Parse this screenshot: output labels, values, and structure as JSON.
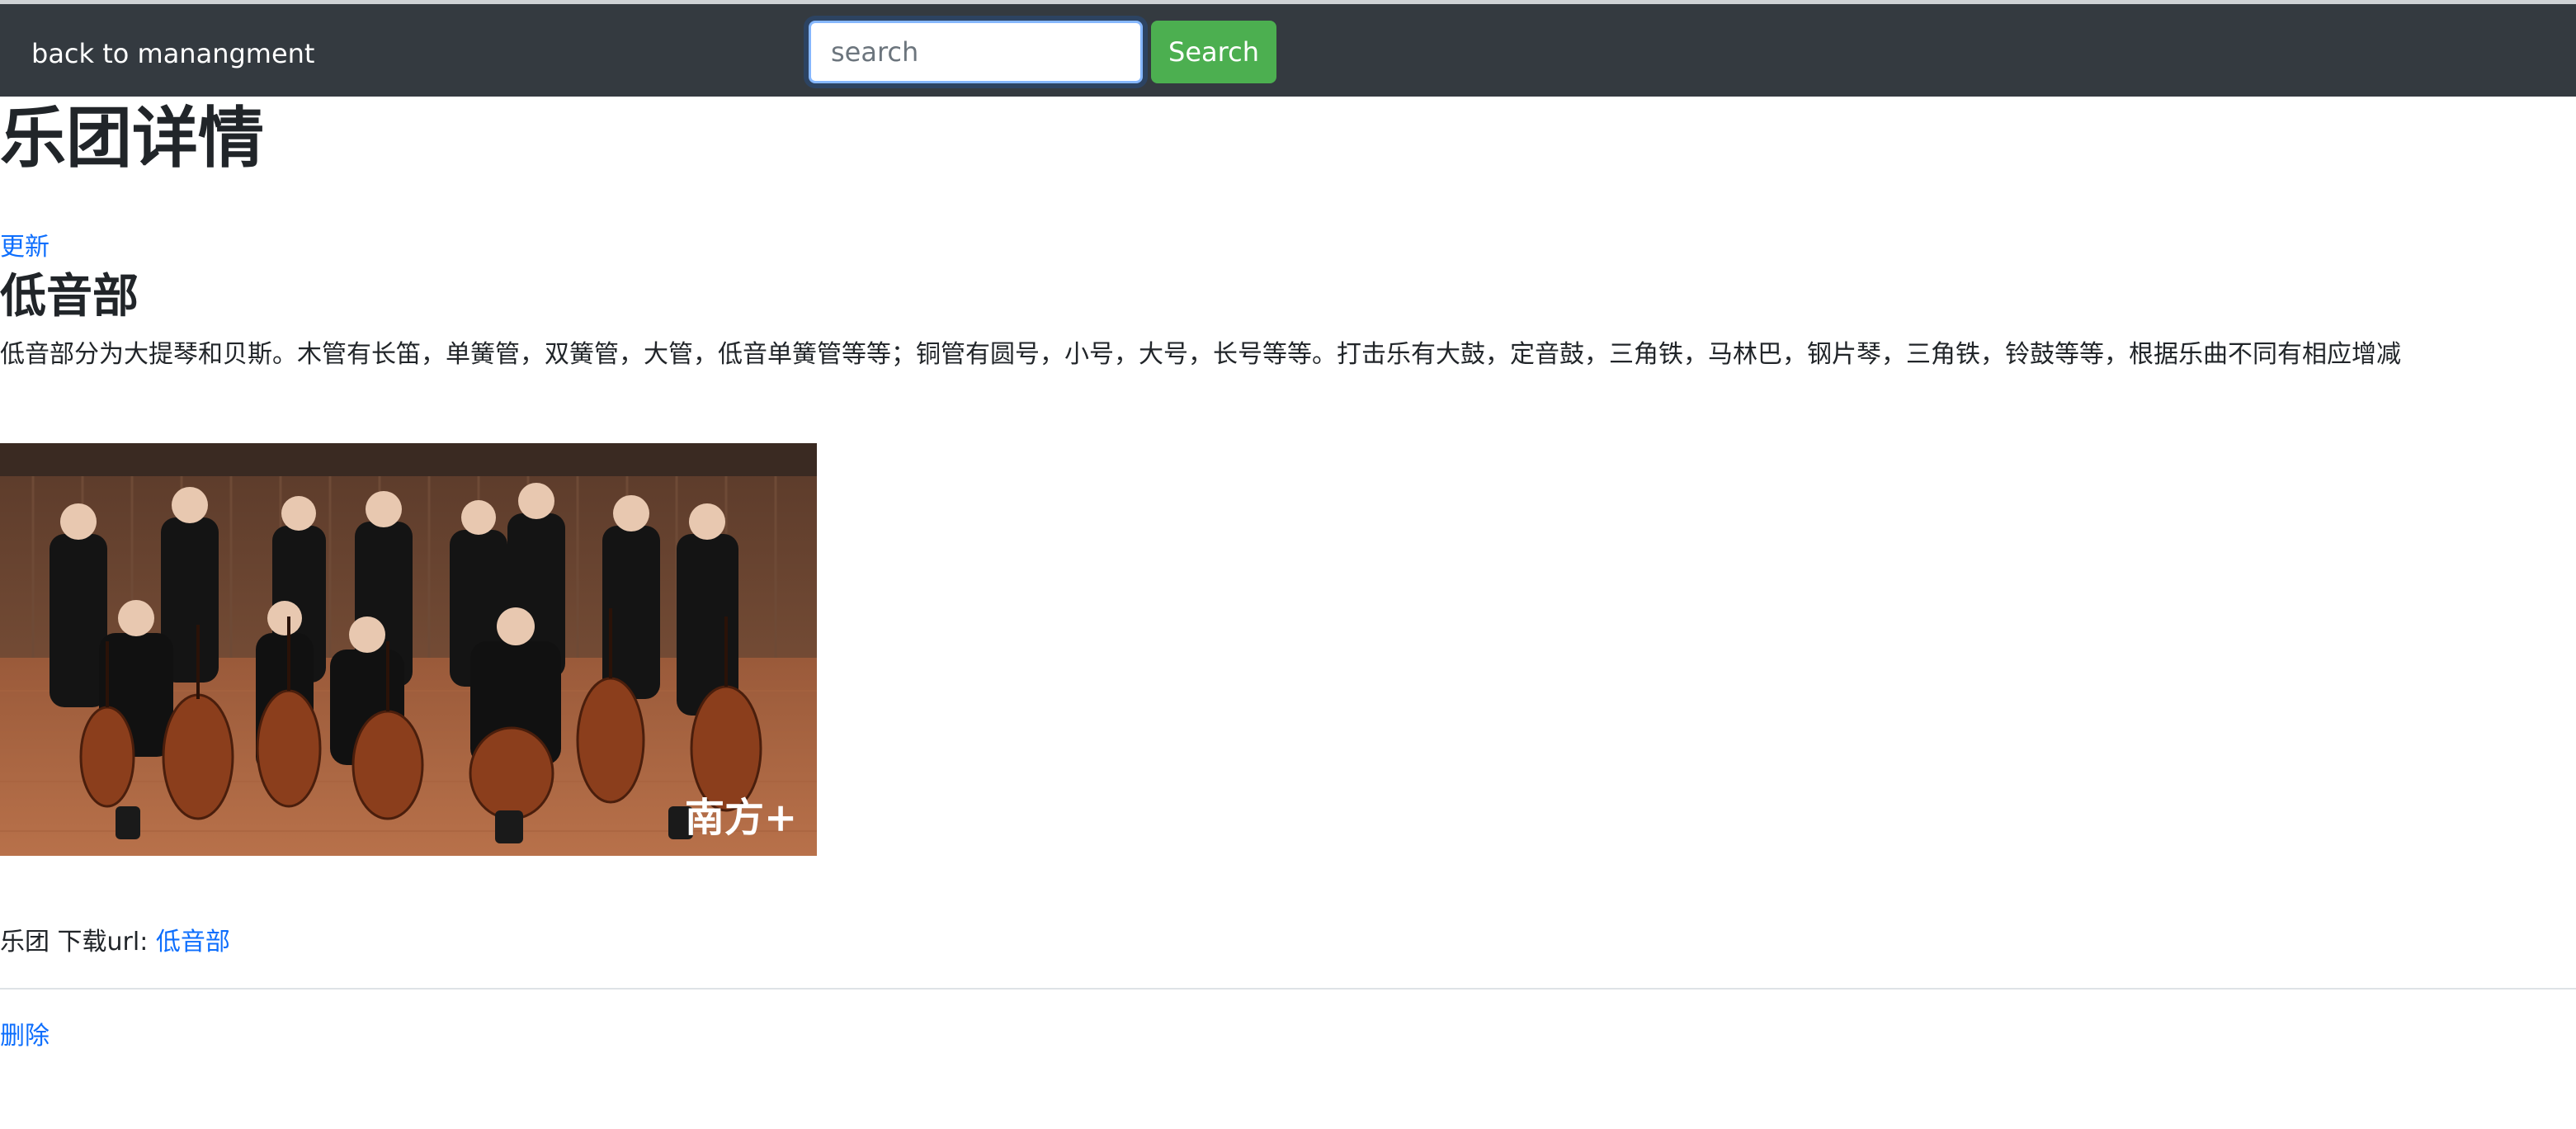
{
  "navbar": {
    "back_link": "back to manangment",
    "search_placeholder": "search",
    "search_value": "",
    "search_button": "Search",
    "background_color": "#343a40",
    "button_color": "#4caf50"
  },
  "page": {
    "title": "乐团详情",
    "update_link": "更新",
    "band_name": "低音部",
    "description": "低音部分为大提琴和贝斯。木管有长笛，单簧管，双簧管，大管，低音单簧管等等；铜管有圆号，小号，大号，长号等等。打击乐有大鼓，定音鼓，三角铁，马林巴，钢片琴，三角铁，铃鼓等等，根据乐曲不同有相应增减",
    "image_watermark": "南方+",
    "download_prefix": "乐团 下载url: ",
    "download_link": "低音部",
    "delete_link": "删除",
    "link_color": "#0d6efd"
  }
}
